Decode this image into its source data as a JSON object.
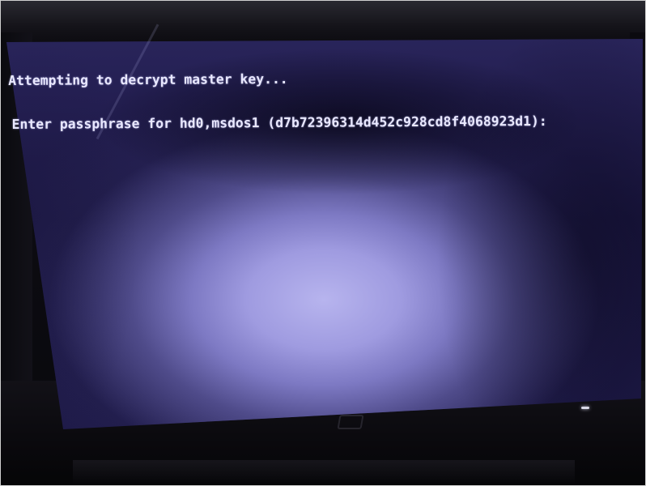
{
  "terminal": {
    "line1": "Attempting to decrypt master key...",
    "line2": "Enter passphrase for hd0,msdos1 (d7b72396314d452c928cd8f4068923d1):"
  },
  "colors": {
    "screen_glow": "#b7b4ee",
    "screen_base": "#241f52",
    "text": "#e9e8ff",
    "bezel": "#0b0a10"
  }
}
